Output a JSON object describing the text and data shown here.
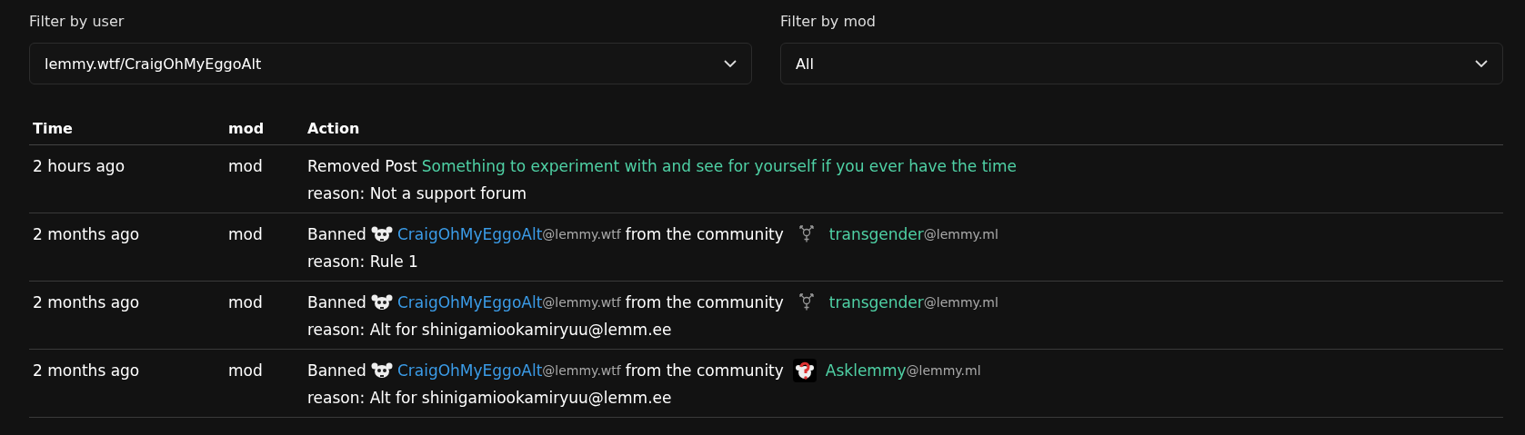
{
  "filters": [
    {
      "label": "Filter by user",
      "value": "lemmy.wtf/CraigOhMyEggoAlt"
    },
    {
      "label": "Filter by mod",
      "value": "All"
    }
  ],
  "table": {
    "columns": [
      "Time",
      "mod",
      "Action"
    ],
    "rows": [
      {
        "kind": "removed",
        "time": "2 hours ago",
        "mod": "mod",
        "verb": "Removed Post",
        "post": "Something to experiment with and see for yourself if you ever have the time",
        "reason": "reason: Not a support forum"
      },
      {
        "kind": "banned",
        "time": "2 months ago",
        "mod": "mod",
        "verb": "Banned",
        "user": "CraigOhMyEggoAlt",
        "user_instance": "@lemmy.wtf",
        "middle": "from the community",
        "community": {
          "kind": "symbol",
          "name": "transgender",
          "instance": "@lemmy.ml"
        },
        "reason": "reason: Rule 1"
      },
      {
        "kind": "banned",
        "time": "2 months ago",
        "mod": "mod",
        "verb": "Banned",
        "user": "CraigOhMyEggoAlt",
        "user_instance": "@lemmy.wtf",
        "middle": "from the community",
        "community": {
          "kind": "symbol",
          "name": "transgender",
          "instance": "@lemmy.ml"
        },
        "reason": "reason: Alt for shinigamiookamiryuu@lemm.ee"
      },
      {
        "kind": "banned",
        "time": "2 months ago",
        "mod": "mod",
        "verb": "Banned",
        "user": "CraigOhMyEggoAlt",
        "user_instance": "@lemmy.wtf",
        "middle": "from the community",
        "community": {
          "kind": "avatar",
          "name": "Asklemmy",
          "instance": "@lemmy.ml"
        },
        "reason": "reason: Alt for shinigamiookamiryuu@lemm.ee"
      }
    ]
  }
}
